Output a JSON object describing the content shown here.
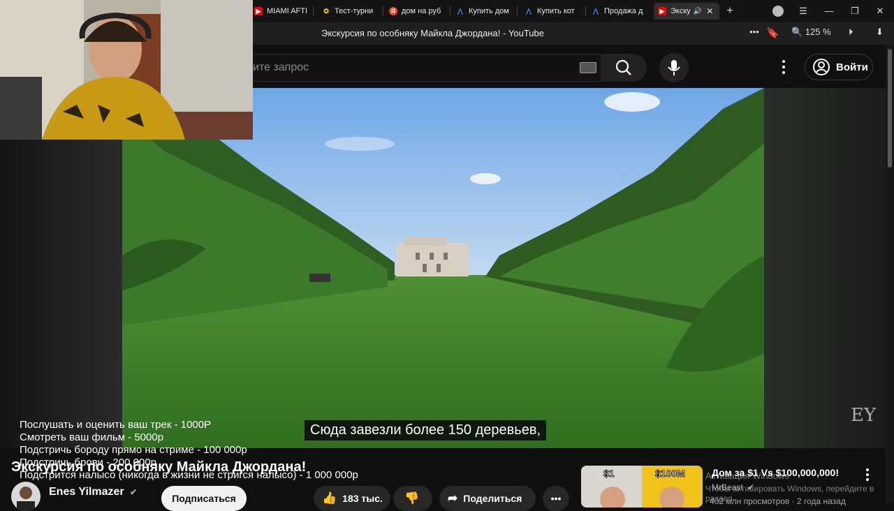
{
  "browser": {
    "tabs": [
      {
        "label": "MIAMI AFTI",
        "icon": "youtube-icon"
      },
      {
        "label": "Тест-турни",
        "icon": "star-icon"
      },
      {
        "label": "дом на руб",
        "icon": "yandex-icon"
      },
      {
        "label": "Купить дом",
        "icon": "avito-icon"
      },
      {
        "label": "Купить кот",
        "icon": "avito-icon"
      },
      {
        "label": "Продажа д",
        "icon": "avito-icon"
      },
      {
        "label": "Экску",
        "icon": "youtube-icon",
        "active": true
      }
    ],
    "page_title": "Экскурсия по особняку Майкла Джордана! - YouTube",
    "zoom": "125 %"
  },
  "youtube": {
    "search_placeholder": "ите запрос",
    "login_label": "Войти"
  },
  "overlay": {
    "lines": [
      "Послушать и оценить ваш трек - 1000Р",
      "Смотреть ваш фильм - 5000р",
      "Подстричь бороду прямо на стриме - 100 000р",
      "Подстричь брови - 200 000р",
      "Подстрится налысо (никогда в жизни не стригся налысо) - 1 000 000р"
    ]
  },
  "video": {
    "subtitle": "Сюда завезли более 150 деревьев,",
    "watermark": "EY",
    "title": "Экскурсия по особняку Майкла Джордана!",
    "channel": "Enes Yilmazer",
    "subscribe_label": "Подписаться",
    "likes": "183 тыс.",
    "share_label": "Поделиться"
  },
  "recommendation": {
    "title": "Дом за $1 Vs $100,000,000!",
    "channel": "MrBeast",
    "meta": "402 млн просмотров · 2 года назад",
    "thumb_left": "$1",
    "thumb_right": "$100M"
  },
  "windows_watermark": {
    "line1": "Активация Windows",
    "line2": "Чтобы активировать Windows, перейдите в раздел"
  },
  "colors": {
    "youtube_red": "#ff0000",
    "background": "#0f0f0f",
    "grass": "#3f8a2a",
    "sky": "#8fc1ee"
  }
}
